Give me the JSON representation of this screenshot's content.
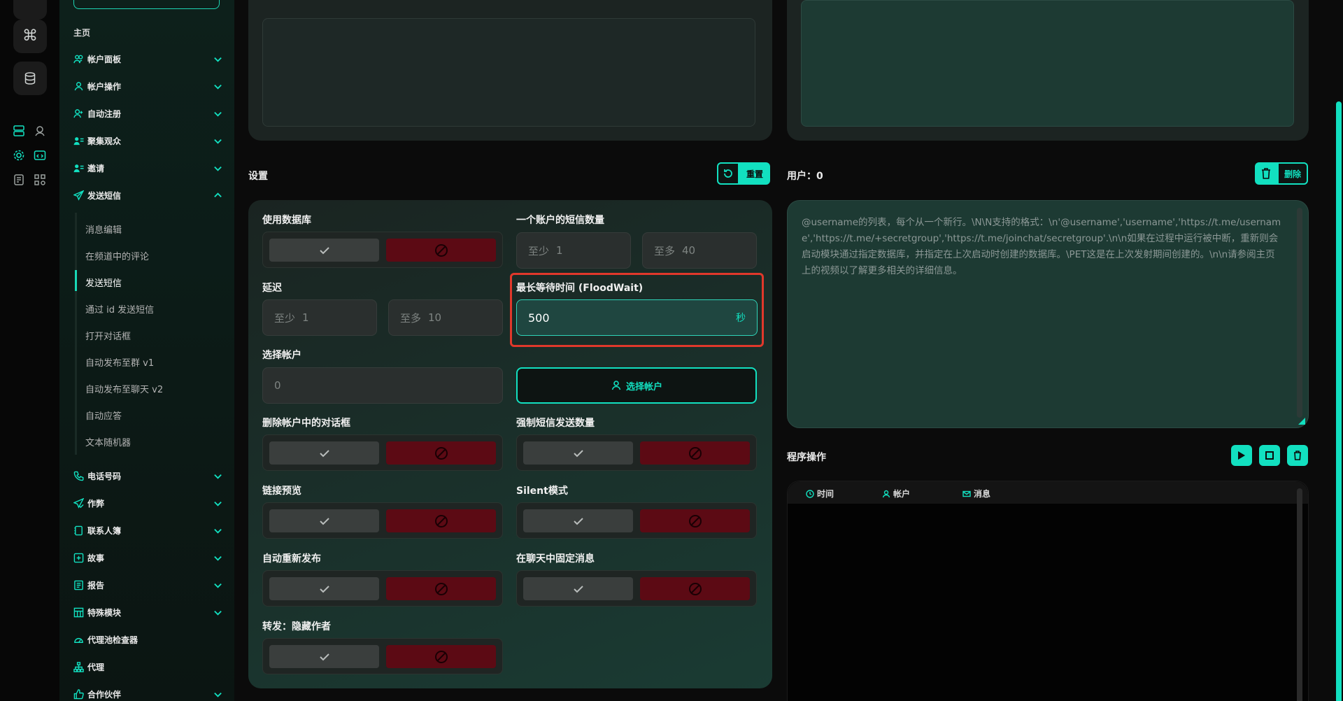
{
  "sidebar": {
    "section_head": "主页",
    "items": [
      {
        "label": "帐户面板",
        "icon": "users-icon"
      },
      {
        "label": "帐户操作",
        "icon": "user-icon"
      },
      {
        "label": "自动注册",
        "icon": "user-plus-icon"
      },
      {
        "label": "聚集观众",
        "icon": "user-list-icon"
      },
      {
        "label": "邀请",
        "icon": "user-list-icon"
      },
      {
        "label": "发送短信",
        "icon": "send-icon"
      }
    ],
    "sub_items": [
      "消息编辑",
      "在频道中的评论",
      "发送短信",
      "通过 id 发送短信",
      "打开对话框",
      "自动发布至群 v1",
      "自动发布至聊天 v2",
      "自动应答",
      "文本随机器"
    ],
    "items2": [
      {
        "label": "电话号码",
        "icon": "phone-icon"
      },
      {
        "label": "作弊",
        "icon": "send-check-icon"
      },
      {
        "label": "联系人簿",
        "icon": "contacts-icon"
      },
      {
        "label": "故事",
        "icon": "plus-square-icon"
      },
      {
        "label": "报告",
        "icon": "report-icon"
      },
      {
        "label": "特殊模块",
        "icon": "grid-icon"
      },
      {
        "label": "代理池检查器",
        "icon": "gauge-icon"
      },
      {
        "label": "代理",
        "icon": "network-icon"
      },
      {
        "label": "合作伙伴",
        "icon": "thumb-icon"
      }
    ]
  },
  "settings": {
    "title": "设置",
    "reset_label": "重置",
    "use_db_label": "使用数据库",
    "sms_per_account_label": "一个账户的短信数量",
    "sms_min_prefix": "至少",
    "sms_min_value": "1",
    "sms_max_prefix": "至多",
    "sms_max_value": "40",
    "delay_label": "延迟",
    "delay_min_prefix": "至少",
    "delay_min_value": "1",
    "delay_max_prefix": "至多",
    "delay_max_value": "10",
    "floodwait_label": "最长等待时间 (FloodWait)",
    "floodwait_value": "500",
    "floodwait_unit": "秒",
    "select_accounts_label": "选择帐户",
    "accounts_value": "0",
    "select_accounts_button": "选择帐户",
    "delete_dialogs_label": "删除帐户中的对话框",
    "force_sms_label": "强制短信发送数量",
    "link_preview_label": "链接预览",
    "silent_label": "Silent模式",
    "auto_repost_label": "自动重新发布",
    "pin_message_label": "在聊天中固定消息",
    "forward_label": "转发：隐藏作者"
  },
  "users": {
    "title": "用户：0",
    "delete_label": "删除",
    "placeholder": "@username的列表，每个从一个新行。\\N\\N支持的格式：\\n'@username','username','https://t.me/username','https://t.me/+secretgroup','https://t.me/joinchat/secretgroup'.\\n\\n如果在过程中运行被中断，重新则会启动模块通过指定数据库，并指定在上次启动时创建的数据库。\\PET这是在上次发射期间创建的。\\n\\n请参阅主页上的视频以了解更多相关的详细信息。"
  },
  "program": {
    "title": "程序操作",
    "col_time": "时间",
    "col_account": "帐户",
    "col_message": "消息"
  },
  "colors": {
    "accent": "#12e0c0",
    "danger": "#5c0a14",
    "highlight": "#e0382b"
  }
}
